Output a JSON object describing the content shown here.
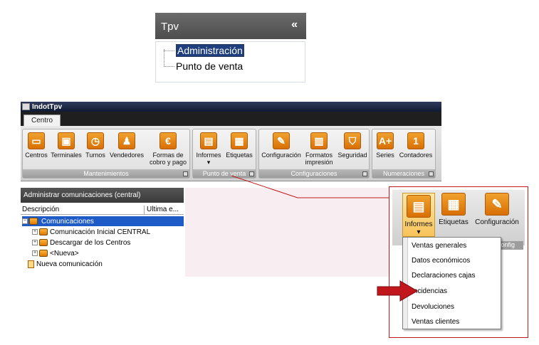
{
  "tpv": {
    "title": "Tpv",
    "collapse_glyph": "«",
    "items": [
      {
        "label": "Administración",
        "selected": true
      },
      {
        "label": "Punto de venta",
        "selected": false
      }
    ]
  },
  "app": {
    "title": "IndotTpv",
    "tab": "Centro",
    "groups": {
      "mantenimientos": "Mantenimientos",
      "punto_venta": "Punto de venta",
      "configuraciones": "Configuraciones",
      "numeraciones": "Numeraciones"
    },
    "buttons": {
      "centros": "Centros",
      "terminales": "Terminales",
      "turnos": "Turnos",
      "vendedores": "Vendedores",
      "formas_1": "Formas de",
      "formas_2": "cobro y pago",
      "informes": "Informes",
      "etiquetas": "Etiquetas",
      "configuracion": "Configuración",
      "formatos_1": "Formatos",
      "formatos_2": "impresión",
      "seguridad": "Seguridad",
      "series": "Series",
      "contadores": "Contadores"
    },
    "glyphs": {
      "euro": "€",
      "series": "A+",
      "contadores": "1",
      "dropdown": "▾"
    },
    "left_pane": {
      "title": "Administrar comunicaciones (central)",
      "col_descripcion": "Descripción",
      "col_ultima": "Ultima e...",
      "tree": [
        {
          "label": "Comunicaciones",
          "selected": true
        },
        {
          "label": "Comunicación Inicial CENTRAL"
        },
        {
          "label": "Descargar de los Centros"
        },
        {
          "label": "<Nueva>"
        },
        {
          "label": "Nueva comunicación"
        }
      ]
    }
  },
  "zoom": {
    "buttons": {
      "informes": "Informes",
      "etiquetas": "Etiquetas",
      "configuracion": "Configuración"
    },
    "group_label": "Config",
    "menu": [
      "Ventas generales",
      "Datos económicos",
      "Declaraciones cajas",
      "Incidencias",
      "Devoluciones",
      "Ventas clientes"
    ]
  },
  "colors": {
    "accent_orange": "#e8870f",
    "callout_red": "#c11a1a",
    "selection_blue": "#1e5bc6"
  }
}
